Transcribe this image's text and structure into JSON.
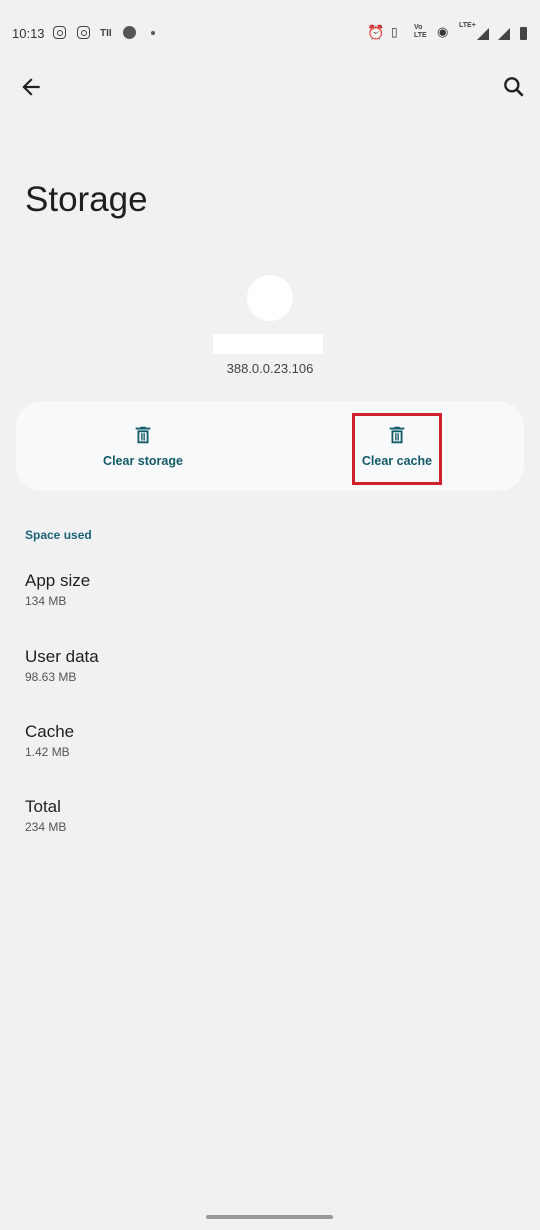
{
  "status_bar": {
    "time": "10:13",
    "lte_label": "LTE+",
    "volte_label": "Vo LTE",
    "icons": [
      "instagram-icon",
      "instagram-icon",
      "carrier-icon",
      "dot-icon",
      "alarm-icon",
      "vibrate-icon",
      "volte-icon",
      "hotspot-icon",
      "signal-icon",
      "signal-icon",
      "battery-icon"
    ]
  },
  "header": {
    "back_icon": "arrow-left",
    "search_icon": "search",
    "title": "Storage"
  },
  "app": {
    "version": "388.0.0.23.106"
  },
  "actions": [
    {
      "label": "Clear storage",
      "icon": "trash"
    },
    {
      "label": "Clear cache",
      "icon": "trash",
      "highlighted": true
    }
  ],
  "colors": {
    "accent": "#135b69",
    "highlight": "#d0202c",
    "background": "#f1f1f3"
  },
  "space_used": {
    "heading": "Space used",
    "items": [
      {
        "label": "App size",
        "value": "134 MB"
      },
      {
        "label": "User data",
        "value": "98.63 MB"
      },
      {
        "label": "Cache",
        "value": "1.42 MB"
      },
      {
        "label": "Total",
        "value": "234 MB"
      }
    ]
  }
}
